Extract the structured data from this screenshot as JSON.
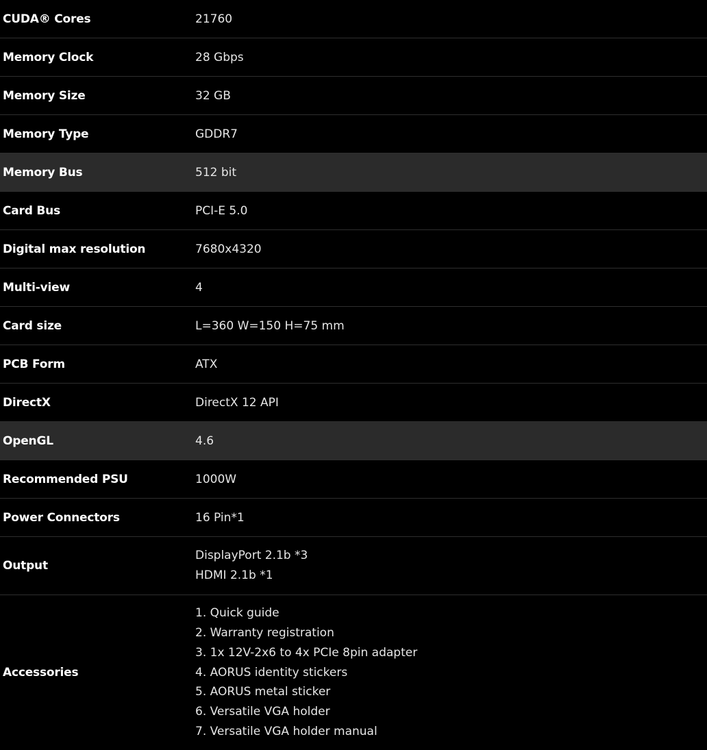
{
  "specs": {
    "rows": [
      {
        "label": "CUDA® Cores",
        "value": "21760"
      },
      {
        "label": "Memory Clock",
        "value": "28 Gbps"
      },
      {
        "label": "Memory Size",
        "value": "32 GB"
      },
      {
        "label": "Memory Type",
        "value": "GDDR7"
      },
      {
        "label": "Memory Bus",
        "value": "512 bit"
      },
      {
        "label": "Card Bus",
        "value": "PCI-E 5.0"
      },
      {
        "label": "Digital max resolution",
        "value": "7680x4320"
      },
      {
        "label": "Multi-view",
        "value": "4"
      },
      {
        "label": "Card size",
        "value": "L=360 W=150 H=75 mm"
      },
      {
        "label": "PCB Form",
        "value": "ATX"
      },
      {
        "label": "DirectX",
        "value": "DirectX 12 API"
      },
      {
        "label": "OpenGL",
        "value": "4.6"
      },
      {
        "label": "Recommended PSU",
        "value": "1000W"
      },
      {
        "label": "Power Connectors",
        "value": "16 Pin*1"
      }
    ],
    "output": {
      "label": "Output",
      "lines": [
        "DisplayPort 2.1b *3",
        "HDMI 2.1b *1"
      ]
    },
    "accessories": {
      "label": "Accessories",
      "lines": [
        "1. Quick guide",
        "2. Warranty registration",
        "3. 1x 12V-2x6 to 4x PCIe 8pin adapter",
        "4. AORUS identity stickers",
        "5. AORUS metal sticker",
        "6. Versatile VGA holder",
        "7. Versatile VGA holder manual"
      ]
    }
  },
  "colors": {
    "background": "#000000",
    "highlight_row": "#2b2b2b",
    "divider": "#2e2e2e",
    "text": "#ffffff"
  }
}
